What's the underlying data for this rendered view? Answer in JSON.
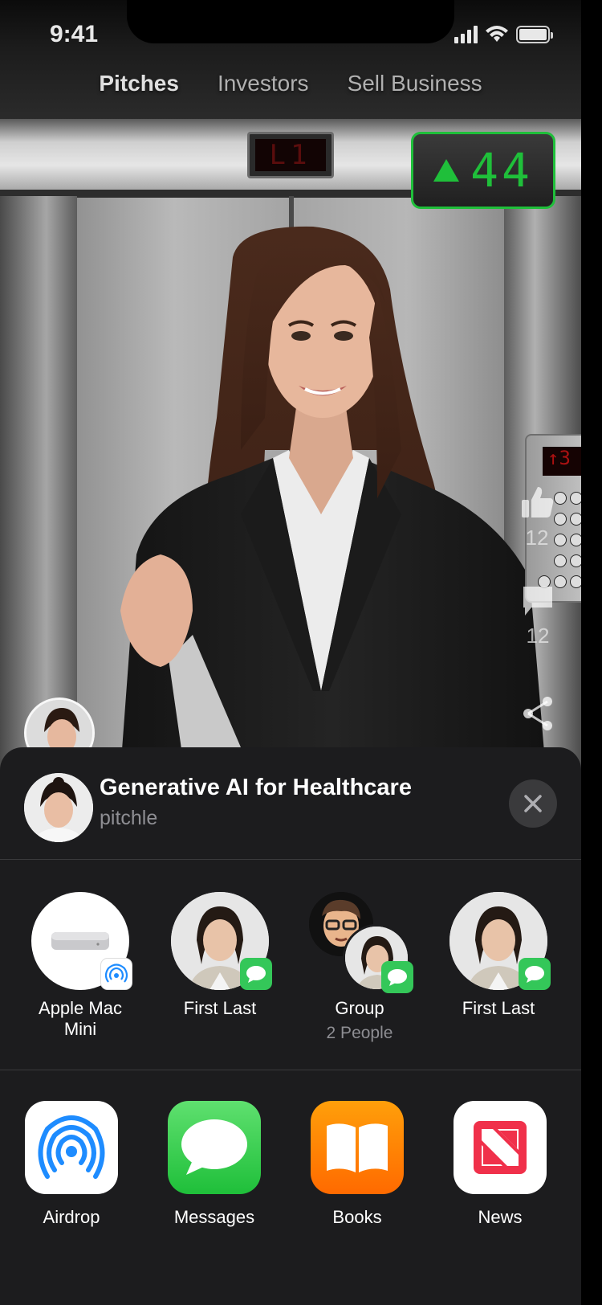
{
  "status_bar": {
    "time": "9:41"
  },
  "tabs": [
    {
      "label": "Pitches",
      "active": true
    },
    {
      "label": "Investors",
      "active": false
    },
    {
      "label": "Sell Business",
      "active": false
    }
  ],
  "elevator": {
    "floor_display": "L1",
    "counter_value": "44",
    "counter_color": "#1fbf3a",
    "keypad_display": "↑3"
  },
  "actions": {
    "like_icon": "thumbs-up-icon",
    "like_count": "12",
    "comment_icon": "comment-icon",
    "comment_count": "12",
    "share_icon": "share-icon"
  },
  "share_sheet": {
    "title": "Generative AI for Healthcare",
    "subtitle": "pitchle",
    "close_icon": "close-icon",
    "people": [
      {
        "label": "Apple Mac Mini",
        "sub": "",
        "badge": "airdrop"
      },
      {
        "label": "First Last",
        "sub": "",
        "badge": "messages"
      },
      {
        "label": "Group",
        "sub": "2 People",
        "badge": "messages"
      },
      {
        "label": "First Last",
        "sub": "",
        "badge": "messages"
      }
    ],
    "apps": [
      {
        "label": "Airdrop",
        "icon": "airdrop-icon"
      },
      {
        "label": "Messages",
        "icon": "messages-icon"
      },
      {
        "label": "Books",
        "icon": "books-icon"
      },
      {
        "label": "News",
        "icon": "news-icon"
      }
    ]
  },
  "colors": {
    "sheet_bg": "#1c1c1e",
    "messages_green": "#34c759",
    "books_orange": "#ff8a00",
    "news_red": "#f0304a",
    "airdrop_blue": "#1e8cff"
  }
}
